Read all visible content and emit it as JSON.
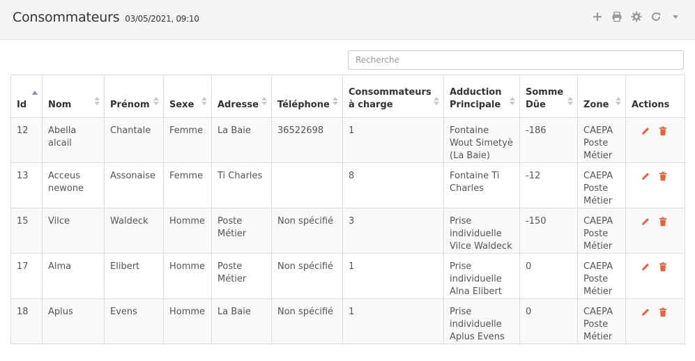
{
  "header": {
    "title": "Consommateurs",
    "timestamp": "03/05/2021, 09:10",
    "tools": [
      "plus-icon",
      "print-icon",
      "gear-icon",
      "refresh-icon",
      "caret-down-icon"
    ]
  },
  "search": {
    "placeholder": "Recherche",
    "value": ""
  },
  "table": {
    "columns": [
      "Id",
      "Nom",
      "Prénom",
      "Sexe",
      "Adresse",
      "Téléphone",
      "Consommateurs\nà charge",
      "Adduction\nPrincipale",
      "Somme\nDûe",
      "Zone",
      "Actions"
    ],
    "sorted_column": "Id",
    "sorted_direction": "asc",
    "rows": [
      [
        "12",
        "Abella alcail",
        "Chantale",
        "Femme",
        "La Baie",
        "36522698",
        "1",
        "Fontaine Wout Simetyè (La Baie)",
        "-186",
        "CAEPA Poste Métier"
      ],
      [
        "13",
        "Acceus newone",
        "Assonaise",
        "Femme",
        "Ti Charles",
        "",
        "8",
        "Fontaine Ti Charles",
        "-12",
        "CAEPA Poste Métier"
      ],
      [
        "15",
        "Vilce",
        "Waldeck",
        "Homme",
        "Poste Métier",
        "Non spécifié",
        "3",
        "Prise individuelle Vilce Waldeck",
        "-150",
        "CAEPA Poste Métier"
      ],
      [
        "17",
        "Alma",
        "Elibert",
        "Homme",
        "Poste Métier",
        "Non spécifié",
        "1",
        "Prise individuelle Alna Elibert",
        "0",
        "CAEPA Poste Métier"
      ],
      [
        "18",
        "Aplus",
        "Evens",
        "Homme",
        "La Baie",
        "Non spécifié",
        "1",
        "Prise individuelle Aplus Evens",
        "0",
        "CAEPA Poste Métier"
      ]
    ],
    "actions": [
      "edit-icon",
      "trash-icon"
    ]
  },
  "colors": {
    "accent": "#e8643c",
    "sort_active": "#7a8fc8",
    "sort_inactive": "#c8c8c8",
    "toolbar_icon": "#9a9a9a"
  }
}
